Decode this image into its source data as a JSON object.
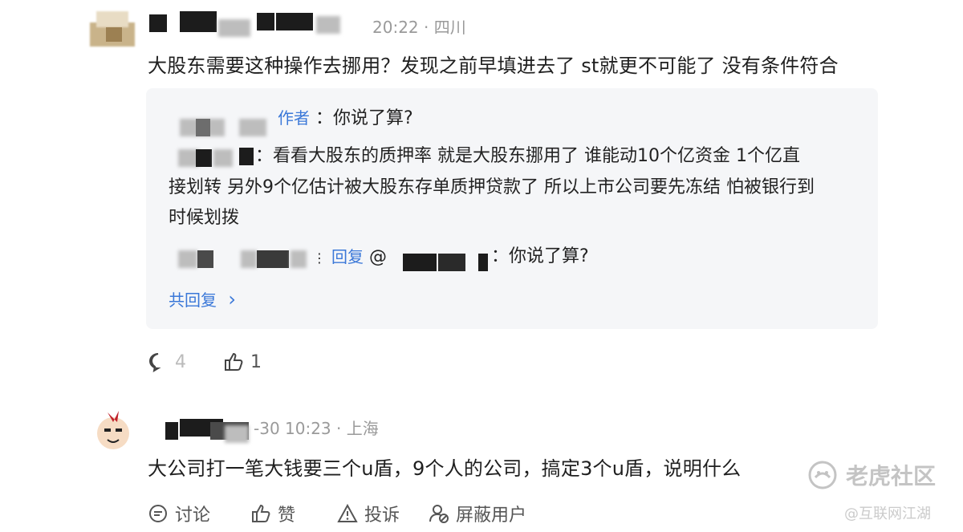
{
  "comment1": {
    "meta": "20:22 · 四川",
    "text": "大股东需要这种操作去挪用？发现之前早填进去了 st就更不可能了 没有条件符合",
    "replies": {
      "line1_author_tag": "作者",
      "line1_text": "：你说了算?",
      "line2_text": "：看看大股东的质押率 就是大股东挪用了 谁能动10个亿资金 1个亿直",
      "line3_text": "接划转 另外9个亿估计被大股东存单质押贷款了 所以上市公司要先冻结 怕被银行到",
      "line4_text": "时候划拨",
      "line5_reply_label": "回复",
      "line5_at": "@",
      "line5_text": "：你说了算?",
      "more_label": "共回复",
      "more_chevron": "›"
    },
    "actions": {
      "comment_count": "4",
      "like_count": "1"
    }
  },
  "comment2": {
    "meta": "-30 10:23 · 上海",
    "text": "大公司打一笔大钱要三个u盾，9个人的公司，搞定3个u盾，说明什么",
    "actions": {
      "comment_label": "讨论",
      "like_label": "赞",
      "report_label": "投诉",
      "block_label": "屏蔽用户"
    }
  },
  "watermark": {
    "brand": "老虎社区",
    "handle": "@互联网江湖"
  },
  "colors": {
    "accent": "#3b78d8",
    "reply_bg": "#f5f6f8",
    "meta_gray": "#9a9a9a"
  },
  "icons": {
    "comment": "comment-bubble-icon",
    "like": "thumbs-up-icon",
    "report": "warning-triangle-icon",
    "block": "user-block-icon",
    "brand": "tiger-logo-icon"
  }
}
